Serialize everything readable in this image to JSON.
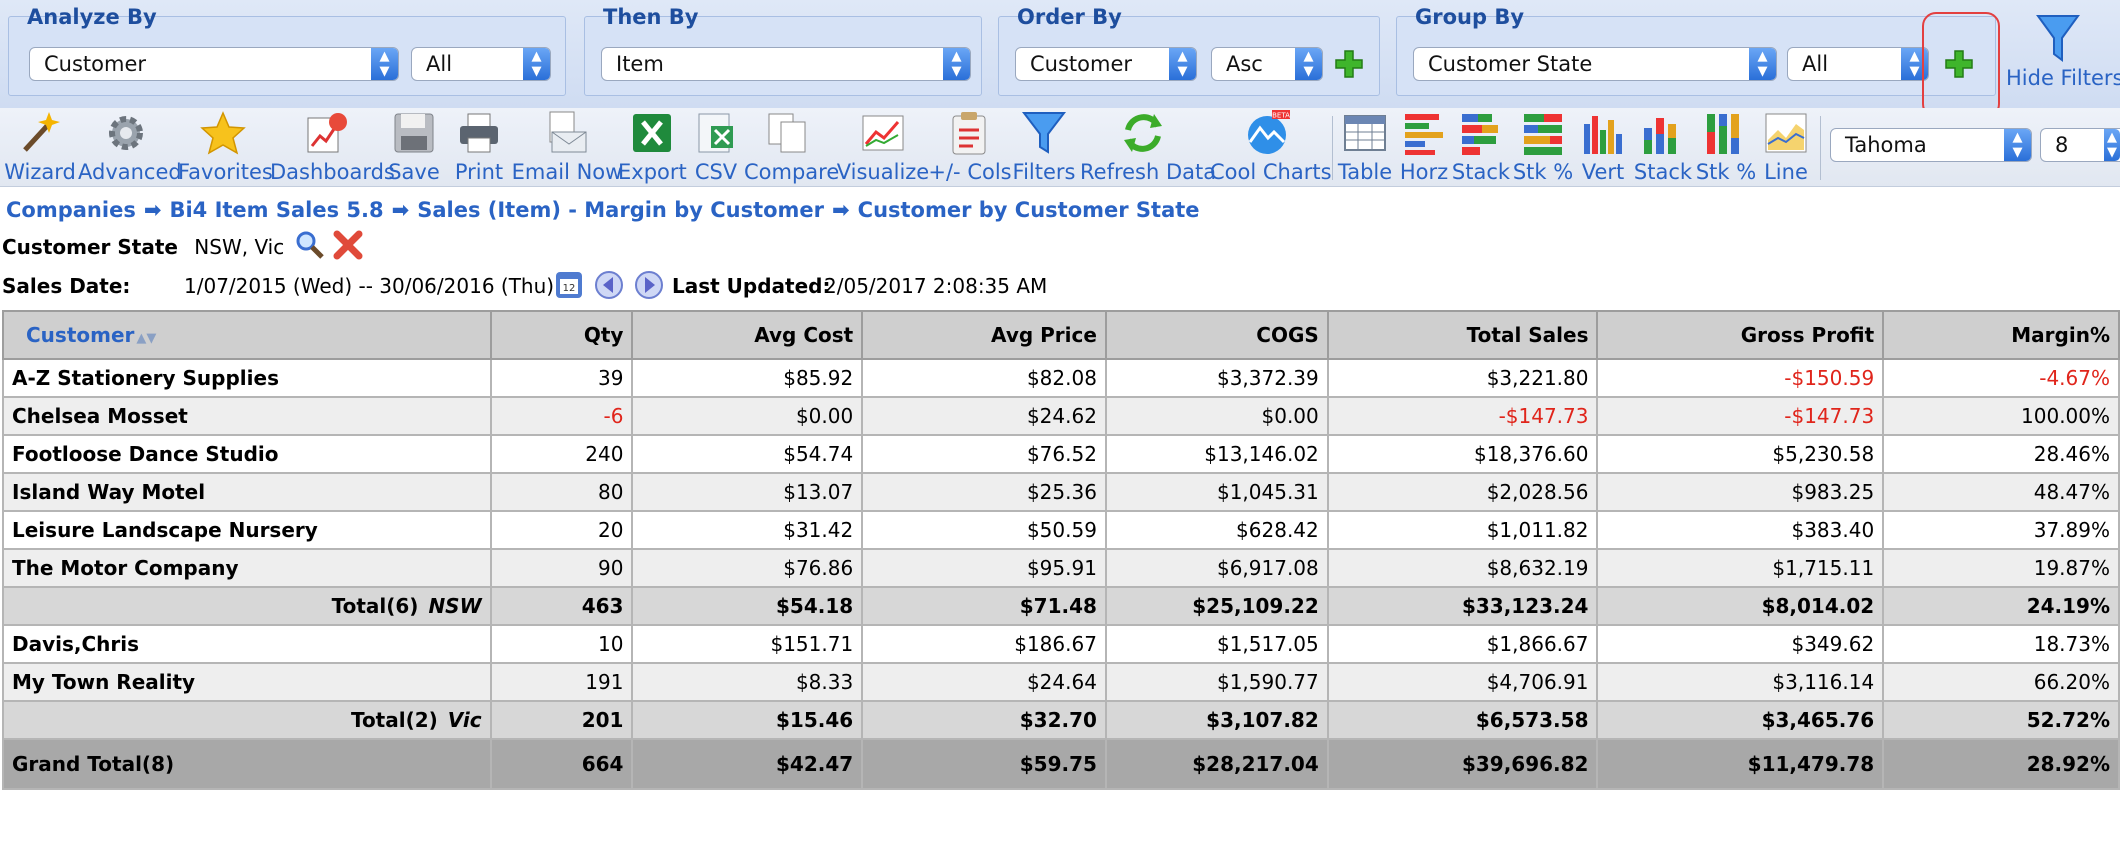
{
  "filters": {
    "analyze_by": {
      "title": "Analyze By",
      "field": "Customer",
      "scope": "All"
    },
    "then_by": {
      "title": "Then By",
      "field": "Item"
    },
    "order_by": {
      "title": "Order By",
      "field": "Customer",
      "direction": "Asc"
    },
    "group_by": {
      "title": "Group By",
      "field": "Customer State",
      "scope": "All"
    },
    "hide_filters_label": "Hide Filters"
  },
  "toolbar": {
    "items": [
      "Wizard",
      "Advanced",
      "Favorites",
      "Dashboards",
      "Save",
      "Print",
      "Email Now",
      "Export",
      "CSV",
      "Compare",
      "Visualize",
      "+/- Cols",
      "Filters",
      "Refresh Data",
      "Cool Charts"
    ],
    "chart_items": [
      "Table",
      "Horz",
      "Stack",
      "Stk %",
      "Vert",
      "Stack",
      "Stk %",
      "Line"
    ],
    "font_name": "Tahoma",
    "font_size": "8",
    "beta_badge": "BETA"
  },
  "breadcrumb": [
    "Companies",
    "Bi4 Item Sales 5.8",
    "Sales (Item) - Margin by Customer",
    "Customer by Customer State"
  ],
  "info": {
    "state_label": "Customer State",
    "state_value": "NSW, Vic",
    "date_label": "Sales Date:",
    "date_value": "1/07/2015 (Wed) -- 30/06/2016 (Thu)",
    "calendar_day": "12",
    "updated_label": "Last Updated:",
    "updated_value": "2/05/2017 2:08:35 AM"
  },
  "table": {
    "columns": [
      "Customer",
      "Qty",
      "Avg Cost",
      "Avg Price",
      "COGS",
      "Total Sales",
      "Gross Profit",
      "Margin%"
    ],
    "rows": [
      {
        "kind": "data",
        "cells": [
          "A-Z Stationery Supplies",
          "39",
          "$85.92",
          "$82.08",
          "$3,372.39",
          "$3,221.80",
          "-$150.59",
          "-4.67%"
        ]
      },
      {
        "kind": "data",
        "cells": [
          "Chelsea Mosset",
          "-6",
          "$0.00",
          "$24.62",
          "$0.00",
          "-$147.73",
          "-$147.73",
          "100.00%"
        ]
      },
      {
        "kind": "data",
        "cells": [
          "Footloose Dance Studio",
          "240",
          "$54.74",
          "$76.52",
          "$13,146.02",
          "$18,376.60",
          "$5,230.58",
          "28.46%"
        ]
      },
      {
        "kind": "data",
        "cells": [
          "Island Way Motel",
          "80",
          "$13.07",
          "$25.36",
          "$1,045.31",
          "$2,028.56",
          "$983.25",
          "48.47%"
        ]
      },
      {
        "kind": "data",
        "cells": [
          "Leisure Landscape Nursery",
          "20",
          "$31.42",
          "$50.59",
          "$628.42",
          "$1,011.82",
          "$383.40",
          "37.89%"
        ]
      },
      {
        "kind": "data",
        "cells": [
          "The Motor Company",
          "90",
          "$76.86",
          "$95.91",
          "$6,917.08",
          "$8,632.19",
          "$1,715.11",
          "19.87%"
        ]
      },
      {
        "kind": "total",
        "label": "Total(6)",
        "group": "NSW",
        "cells": [
          "",
          "463",
          "$54.18",
          "$71.48",
          "$25,109.22",
          "$33,123.24",
          "$8,014.02",
          "24.19%"
        ]
      },
      {
        "kind": "data",
        "cells": [
          "Davis,Chris",
          "10",
          "$151.71",
          "$186.67",
          "$1,517.05",
          "$1,866.67",
          "$349.62",
          "18.73%"
        ]
      },
      {
        "kind": "data",
        "cells": [
          "My Town Reality",
          "191",
          "$8.33",
          "$24.64",
          "$1,590.77",
          "$4,706.91",
          "$3,116.14",
          "66.20%"
        ]
      },
      {
        "kind": "total",
        "label": "Total(2)",
        "group": "Vic",
        "cells": [
          "",
          "201",
          "$15.46",
          "$32.70",
          "$3,107.82",
          "$6,573.58",
          "$3,465.76",
          "52.72%"
        ]
      },
      {
        "kind": "grand",
        "label": "Grand Total(8)",
        "cells": [
          "",
          "664",
          "$42.47",
          "$59.75",
          "$28,217.04",
          "$39,696.82",
          "$11,479.78",
          "28.92%"
        ]
      }
    ]
  },
  "colors": {
    "accent": "#2a63c4",
    "negative": "#e0251b",
    "highlight": "#e34040"
  }
}
